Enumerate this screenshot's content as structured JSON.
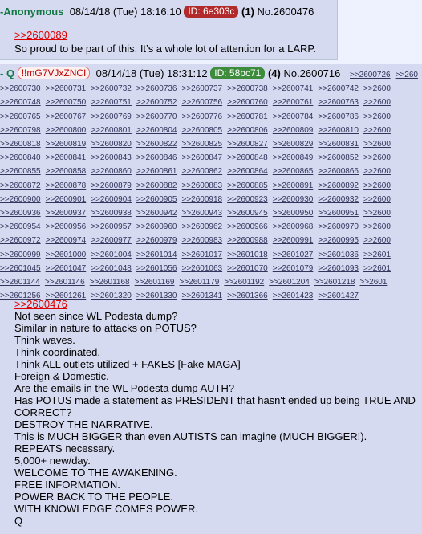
{
  "post1": {
    "name": "Anonymous",
    "date": "08/14/18 (Tue) 18:16:10",
    "id_label": "ID: 6e303c",
    "reply_count": "(1)",
    "post_number": "No.2600476",
    "quote_link": ">>2600089",
    "text": "So proud to be part of this. It’s a whole lot of attention for a LARP."
  },
  "post2": {
    "name": "Q",
    "tripcode": "!!mG7VJxZNCI",
    "date": "08/14/18 (Tue) 18:31:12",
    "id_label": "ID: 58bc71",
    "reply_count": "(4)",
    "post_number": "No.2600716",
    "backlinks": [
      [
        ">>2600726",
        ">>260"
      ],
      [
        ">>2600730",
        ">>2600731",
        ">>2600732",
        ">>2600736",
        ">>2600737",
        ">>2600738",
        ">>2600741",
        ">>2600742",
        ">>2600"
      ],
      [
        ">>2600748",
        ">>2600750",
        ">>2600751",
        ">>2600752",
        ">>2600756",
        ">>2600760",
        ">>2600761",
        ">>2600763",
        ">>2600"
      ],
      [
        ">>2600765",
        ">>2600767",
        ">>2600769",
        ">>2600770",
        ">>2600776",
        ">>2600781",
        ">>2600784",
        ">>2600786",
        ">>2600"
      ],
      [
        ">>2600798",
        ">>2600800",
        ">>2600801",
        ">>2600804",
        ">>2600805",
        ">>2600806",
        ">>2600809",
        ">>2600810",
        ">>2600"
      ],
      [
        ">>2600818",
        ">>2600819",
        ">>2600820",
        ">>2600822",
        ">>2600825",
        ">>2600827",
        ">>2600829",
        ">>2600831",
        ">>2600"
      ],
      [
        ">>2600840",
        ">>2600841",
        ">>2600843",
        ">>2600846",
        ">>2600847",
        ">>2600848",
        ">>2600849",
        ">>2600852",
        ">>2600"
      ],
      [
        ">>2600855",
        ">>2600858",
        ">>2600860",
        ">>2600861",
        ">>2600862",
        ">>2600864",
        ">>2600865",
        ">>2600866",
        ">>2600"
      ],
      [
        ">>2600872",
        ">>2600878",
        ">>2600879",
        ">>2600882",
        ">>2600883",
        ">>2600885",
        ">>2600891",
        ">>2600892",
        ">>2600"
      ],
      [
        ">>2600900",
        ">>2600901",
        ">>2600904",
        ">>2600905",
        ">>2600918",
        ">>2600923",
        ">>2600930",
        ">>2600932",
        ">>2600"
      ],
      [
        ">>2600936",
        ">>2600937",
        ">>2600938",
        ">>2600942",
        ">>2600943",
        ">>2600945",
        ">>2600950",
        ">>2600951",
        ">>2600"
      ],
      [
        ">>2600954",
        ">>2600956",
        ">>2600957",
        ">>2600960",
        ">>2600962",
        ">>2600966",
        ">>2600968",
        ">>2600970",
        ">>2600"
      ],
      [
        ">>2600972",
        ">>2600974",
        ">>2600977",
        ">>2600979",
        ">>2600983",
        ">>2600988",
        ">>2600991",
        ">>2600995",
        ">>2600"
      ],
      [
        ">>2600999",
        ">>2601000",
        ">>2601004",
        ">>2601014",
        ">>2601017",
        ">>2601018",
        ">>2601027",
        ">>2601036",
        ">>2601"
      ],
      [
        ">>2601045",
        ">>2601047",
        ">>2601048",
        ">>2601056",
        ">>2601063",
        ">>2601070",
        ">>2601079",
        ">>2601093",
        ">>2601"
      ],
      [
        ">>2601144",
        ">>2601146",
        ">>2601168",
        ">>2601169",
        ">>2601179",
        ">>2601192",
        ">>2601204",
        ">>2601218",
        ">>2601"
      ],
      [
        ">>2601256",
        ">>2601261",
        ">>2601320",
        ">>2601330",
        ">>2601341",
        ">>2601366",
        ">>2601423",
        ">>2601427"
      ]
    ],
    "quote_link": ">>2600476",
    "lines": [
      "Not seen since WL Podesta dump?",
      "Similar in nature to attacks on POTUS?",
      "Think waves.",
      "Think coordinated.",
      "Think ALL outlets utilized + FAKES [Fake MAGA]",
      "Foreign & Domestic.",
      "Are the emails in the WL Podesta dump AUTH?",
      "Has POTUS made a statement as PRESIDENT that hasn't ended up being TRUE AND",
      "CORRECT?",
      "DESTROY THE NARRATIVE.",
      "This is MUCH BIGGER than even AUTISTS can imagine (MUCH BIGGER!).",
      "REPEATS necessary.",
      "5,000+ new/day.",
      "WELCOME TO THE AWAKENING.",
      "FREE INFORMATION.",
      "POWER BACK TO THE PEOPLE.",
      "WITH KNOWLEDGE COMES POWER.",
      "Q"
    ]
  },
  "colors": {
    "post_bg": "#d6daf0",
    "page_bg": "#eef2ff",
    "name_green": "#117743",
    "quote_red": "#dd0000",
    "backlink_blue": "#34345c",
    "id_post1": "#b22a2a",
    "id_post2": "#3c8c3c"
  }
}
